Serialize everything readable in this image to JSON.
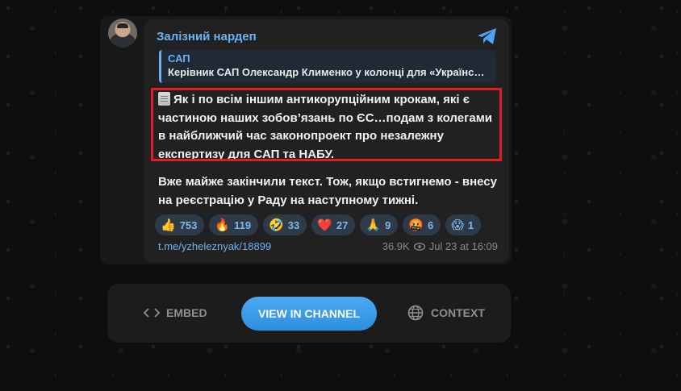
{
  "post": {
    "channel_name": "Залізний нардеп",
    "reply": {
      "title": "САП",
      "text": "Керівник САП Олександр Клименко у колонці для «Українська правда»"
    },
    "message_highlighted": "Як і по всім іншим антикорупційним крокам, які є частиною наших зобов’язань по ЄС…подам з колегами в найближчий час законопроект про незалежну експертизу для САП та НАБУ.",
    "message_rest": "Вже майже закінчили текст. Тож, якщо встигнемо - внесу на реєстрацію у Раду на наступному тижні.",
    "reactions": [
      {
        "emoji": "👍",
        "count": "753"
      },
      {
        "emoji": "🔥",
        "count": "119"
      },
      {
        "emoji": "🤣",
        "count": "33"
      },
      {
        "emoji": "❤️",
        "count": "27"
      },
      {
        "emoji": "🙏",
        "count": "9"
      },
      {
        "emoji": "🤬",
        "count": "6"
      },
      {
        "emoji": "😱",
        "count": "1"
      }
    ],
    "link": "t.me/yzheleznyak/18899",
    "views": "36.9K",
    "date": "Jul 23 at 16:09"
  },
  "actions": {
    "embed_label": "EMBED",
    "view_label": "VIEW IN CHANNEL",
    "context_label": "CONTEXT"
  },
  "colors": {
    "accent": "#6ab3f3",
    "highlight_border": "#e01c24",
    "button": "#3a9ae8"
  }
}
